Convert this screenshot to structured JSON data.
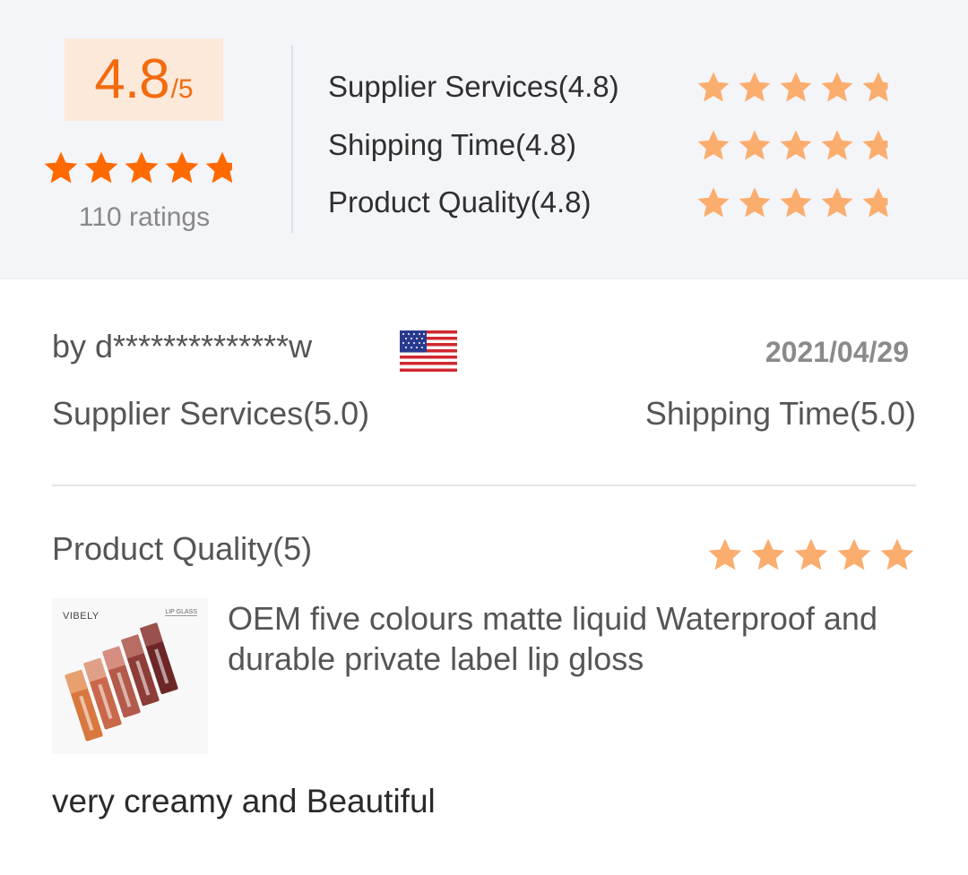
{
  "summary": {
    "score": "4.8",
    "score_denominator": "/5",
    "overall_stars": 4.8,
    "ratings_count": "110 ratings",
    "metrics": [
      {
        "label": "Supplier Services(4.8)",
        "stars": 4.8
      },
      {
        "label": "Shipping Time(4.8)",
        "stars": 4.8
      },
      {
        "label": "Product Quality(4.8)",
        "stars": 4.8
      }
    ]
  },
  "review": {
    "user": "by d**************w",
    "country_flag": "us-flag-icon",
    "date": "2021/04/29",
    "supplier_services": "Supplier Services(5.0)",
    "shipping_time": "Shipping Time(5.0)",
    "product_quality_label": "Product Quality(5)",
    "product_quality_stars": 5,
    "product": {
      "thumbnail_brand": "VIBELY",
      "thumbnail_label": "LIP GLASS",
      "title": "OEM  five colours matte liquid Waterproof and durable private label lip gloss"
    },
    "comment": "very creamy and Beautiful"
  },
  "colors": {
    "accent_orange": "#f26b0f",
    "overall_star": "#ff6a00",
    "metric_star": "#fbad6e",
    "score_bg": "#fde9d9",
    "panel_bg": "#f4f5f9"
  }
}
